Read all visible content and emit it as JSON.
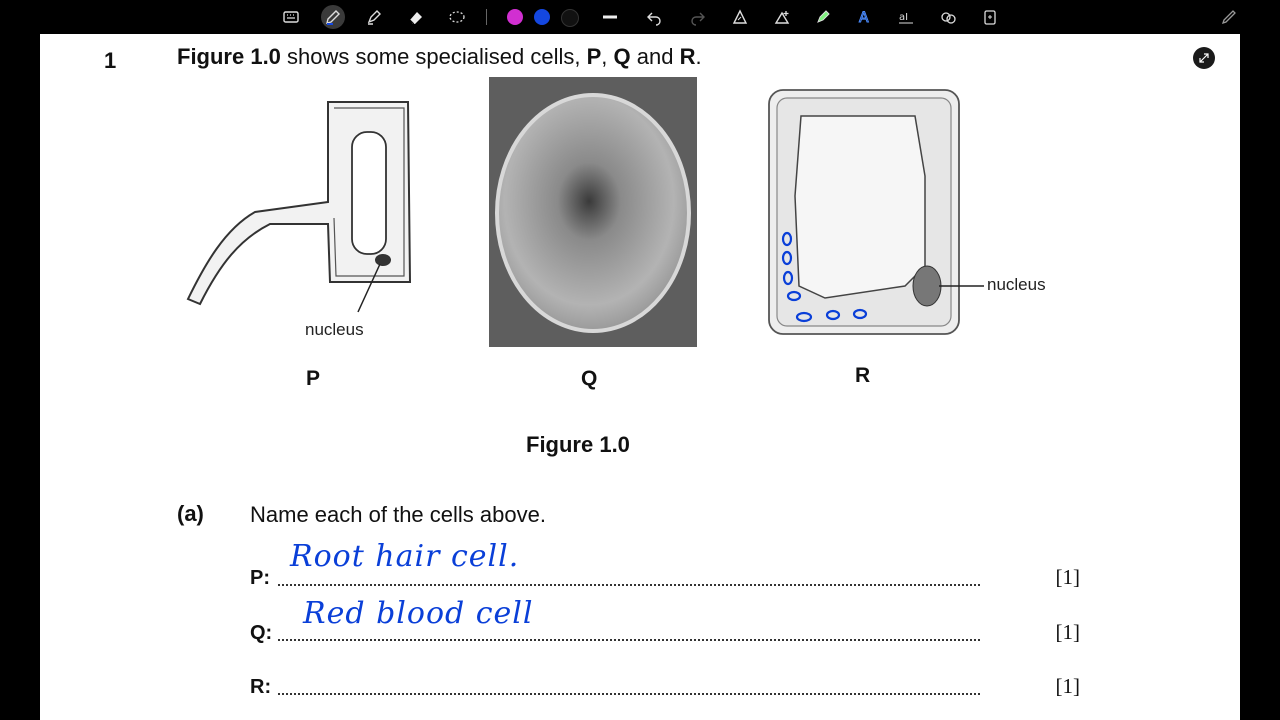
{
  "toolbar": {
    "tools": [
      "keyboard-icon",
      "pen-icon",
      "highlighter-icon",
      "eraser-icon",
      "lasso-icon",
      "separator",
      "color-magenta",
      "color-blue",
      "color-black",
      "line-width-icon",
      "undo-icon",
      "redo-icon",
      "shapes-icon",
      "insert-image-icon",
      "text-highlighter-icon",
      "text-a-icon",
      "text-box-icon",
      "shapes-circles-icon",
      "more-icon"
    ],
    "colors": {
      "magenta": "#d12fd1",
      "blue": "#1447e0",
      "black": "#111111"
    },
    "active_tool": "pen-icon"
  },
  "question": {
    "number": "1",
    "figure_ref": "Figure 1.0",
    "text_mid": " shows some specialised cells, ",
    "p": "P",
    "comma": ", ",
    "q": "Q",
    "and": " and ",
    "r": "R",
    "period": "."
  },
  "figure": {
    "p_nucleus_label": "nucleus",
    "r_nucleus_label": "nucleus",
    "cell_p": "P",
    "cell_q": "Q",
    "cell_r": "R",
    "caption": "Figure 1.0"
  },
  "part_a": {
    "label": "(a)",
    "text": "Name each of the cells above.",
    "rows": [
      {
        "label": "P:",
        "answer": "Root hair cell.",
        "mark": "[1]"
      },
      {
        "label": "Q:",
        "answer": "Red blood cell",
        "mark": "[1]"
      },
      {
        "label": "R:",
        "answer": "",
        "mark": "[1]"
      }
    ]
  }
}
